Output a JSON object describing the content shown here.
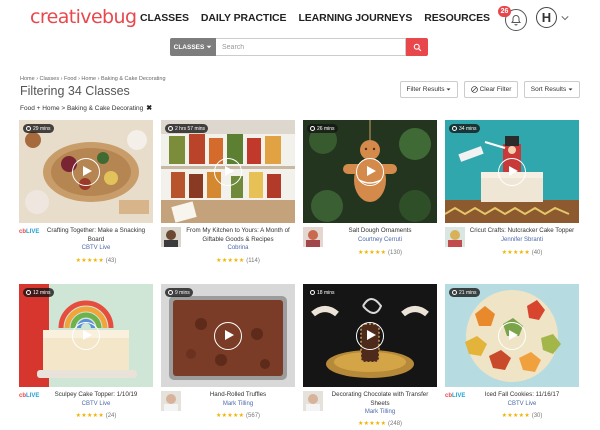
{
  "header": {
    "logo": "creativebug",
    "nav": [
      "CLASSES",
      "DAILY PRACTICE",
      "LEARNING JOURNEYS",
      "RESOURCES"
    ],
    "notification_count": "26",
    "avatar_initial": "H"
  },
  "search": {
    "category_label": "CLASSES",
    "placeholder": "Search"
  },
  "filters": {
    "breadcrumb": "Home › Classes › Food › Home › Baking & Cake Decorating",
    "title": "Filtering 34 Classes",
    "active_filter": "Food + Home > Baking & Cake Decorating",
    "filter_results_label": "Filter Results",
    "clear_filter_label": "Clear Filter",
    "sort_results_label": "Sort Results"
  },
  "cards": [
    {
      "duration": "29 mins",
      "title": "Crafting Together: Make a Snacking Board",
      "author": "CBTV Live",
      "reviews": "(43)",
      "rating": 5
    },
    {
      "duration": "2 hrs 57 mins",
      "title": "From My Kitchen to Yours: A Month of Giftable Goods & Recipes",
      "author": "Cobrina",
      "reviews": "(114)",
      "rating": 5
    },
    {
      "duration": "26 mins",
      "title": "Salt Dough Ornaments",
      "author": "Courtney Cerruti",
      "reviews": "(130)",
      "rating": 5
    },
    {
      "duration": "34 mins",
      "title": "Cricut Crafts: Nutcracker Cake Topper",
      "author": "Jennifer Sbranti",
      "reviews": "(40)",
      "rating": 5
    },
    {
      "duration": "12 mins",
      "title": "Sculpey Cake Topper: 1/10/19",
      "author": "CBTV Live",
      "reviews": "(24)",
      "rating": 5
    },
    {
      "duration": "9 mins",
      "title": "Hand-Rolled Truffles",
      "author": "Mark Tilling",
      "reviews": "(567)",
      "rating": 5
    },
    {
      "duration": "18 mins",
      "title": "Decorating Chocolate with Transfer Sheets",
      "author": "Mark Tilling",
      "reviews": "(248)",
      "rating": 5
    },
    {
      "duration": "21 mins",
      "title": "Iced Fall Cookies: 11/16/17",
      "author": "CBTV Live",
      "reviews": "(30)",
      "rating": 5
    }
  ],
  "badges": {
    "cb": "cb",
    "live": "LIVE"
  },
  "colors": {
    "brand": "#e8474c",
    "author_link": "#4d69a9",
    "star": "#f0b400"
  },
  "icons": [
    "bell-icon",
    "chevron-down-icon",
    "search-icon",
    "clear-icon",
    "clock-icon",
    "play-icon",
    "star-icon"
  ]
}
